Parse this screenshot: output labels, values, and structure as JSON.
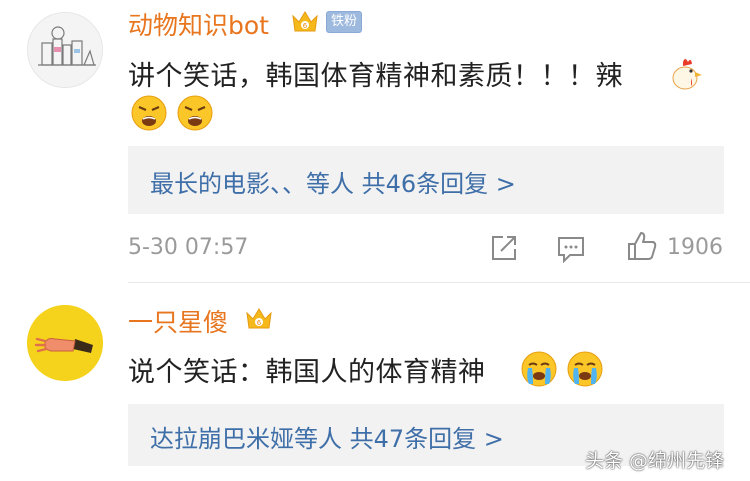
{
  "comments": [
    {
      "username": "动物知识bot",
      "badge": "铁粉",
      "text": "讲个笑话，韩国体育精神和素质！！！辣",
      "replies_label": "最长的电影、、等人  共46条回复 >",
      "time": "5-30 07:57",
      "likes": "1906",
      "icons": [
        "avatar-sketch",
        "vip-crown-icon",
        "rooster-emoji",
        "angry-emoji",
        "angry-emoji"
      ]
    },
    {
      "username": "一只星傻",
      "text": "说个笑话：韩国人的体育精神",
      "replies_label": "达拉崩巴米娅等人  共47条回复 >",
      "icons": [
        "avatar-hand",
        "vip-crown-icon",
        "crying-emoji",
        "crying-emoji"
      ]
    }
  ],
  "actions": {
    "icons": [
      "share-icon",
      "comment-icon",
      "like-icon"
    ]
  },
  "watermark": "头条 @绵州先锋",
  "colors": {
    "username": "#e8761f",
    "link": "#3f6fa8",
    "meta": "#9a9a9a",
    "reply_bg": "#f2f2f2"
  }
}
